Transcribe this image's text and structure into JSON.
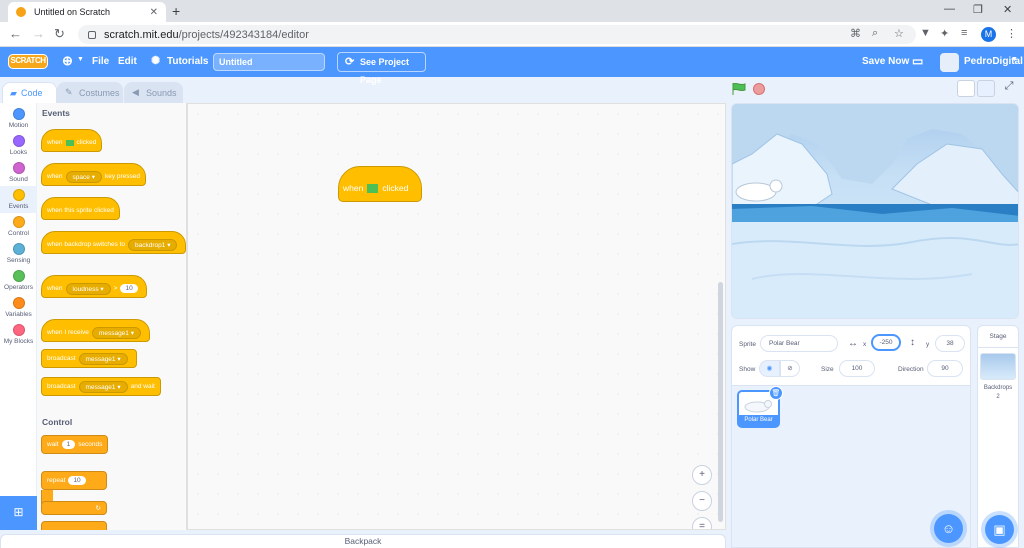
{
  "browser": {
    "tab_title": "Untitled on Scratch",
    "url_host": "scratch.mit.edu",
    "url_path": "/projects/492343184/editor",
    "profile_initial": "M"
  },
  "menu": {
    "logo": "SCRATCH",
    "file": "File",
    "edit": "Edit",
    "tutorials": "Tutorials",
    "project_title": "Untitled",
    "see_project_page": "See Project Page",
    "save_now": "Save Now",
    "username": "PedroDigital"
  },
  "editor_tabs": {
    "code": "Code",
    "costumes": "Costumes",
    "sounds": "Sounds"
  },
  "categories": [
    {
      "label": "Motion",
      "color": "#4c97ff"
    },
    {
      "label": "Looks",
      "color": "#9966ff"
    },
    {
      "label": "Sound",
      "color": "#cf63cf"
    },
    {
      "label": "Events",
      "color": "#ffbf00"
    },
    {
      "label": "Control",
      "color": "#ffab19"
    },
    {
      "label": "Sensing",
      "color": "#5cb1d6"
    },
    {
      "label": "Operators",
      "color": "#59c059"
    },
    {
      "label": "Variables",
      "color": "#ff8c1a"
    },
    {
      "label": "My Blocks",
      "color": "#ff6680"
    }
  ],
  "palette": {
    "events_heading": "Events",
    "control_heading": "Control",
    "blocks": {
      "when": "when",
      "clicked": "clicked",
      "space": "space",
      "key_pressed": "key pressed",
      "when_sprite_clicked": "when this sprite clicked",
      "when_backdrop": "when backdrop switches to",
      "backdrop1": "backdrop1",
      "loudness": "loudness",
      "gt": ">",
      "loudness_val": "10",
      "when_receive": "when I receive",
      "message1": "message1",
      "broadcast": "broadcast",
      "and_wait": "and wait",
      "wait": "wait",
      "wait_val": "1",
      "seconds": "seconds",
      "repeat": "repeat",
      "repeat_val": "10"
    }
  },
  "script": {
    "when": "when",
    "clicked": "clicked"
  },
  "backpack": "Backpack",
  "sprite_info": {
    "sprite_label": "Sprite",
    "sprite_name": "Polar Bear",
    "x_label": "x",
    "x_value": "-250",
    "y_label": "y",
    "y_value": "38",
    "show_label": "Show",
    "size_label": "Size",
    "size_value": "100",
    "direction_label": "Direction",
    "direction_value": "90"
  },
  "sprites": [
    {
      "name": "Polar Bear"
    }
  ],
  "stage_panel": {
    "title": "Stage",
    "backdrops_label": "Backdrops",
    "backdrops_count": "2"
  }
}
